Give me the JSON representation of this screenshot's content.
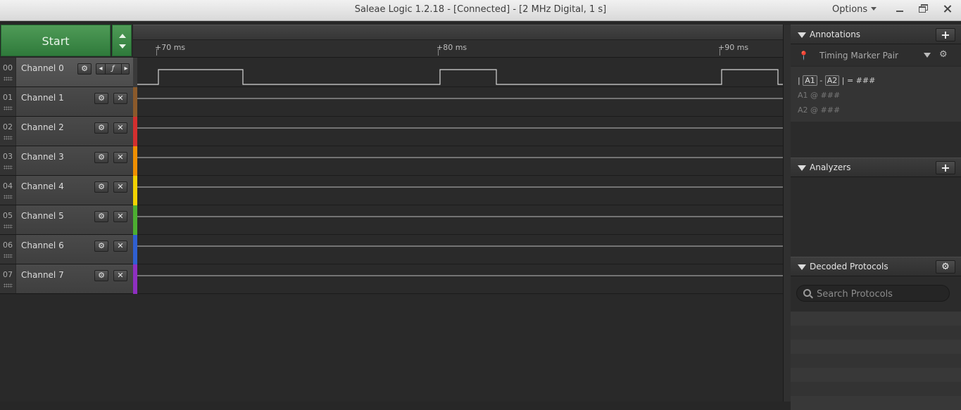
{
  "window": {
    "title": "Saleae Logic 1.2.18 - [Connected] - [2 MHz Digital, 1 s]",
    "options_label": "Options"
  },
  "capture": {
    "start_label": "Start"
  },
  "ruler": {
    "ticks": [
      "+70 ms",
      "+80 ms",
      "+90 ms"
    ]
  },
  "channels": [
    {
      "num": "00",
      "name": "Channel 0",
      "color": "#3a3a3a"
    },
    {
      "num": "01",
      "name": "Channel 1",
      "color": "#8b5a2b"
    },
    {
      "num": "02",
      "name": "Channel 2",
      "color": "#d32f2f"
    },
    {
      "num": "03",
      "name": "Channel 3",
      "color": "#ef8f00"
    },
    {
      "num": "04",
      "name": "Channel 4",
      "color": "#f2d200"
    },
    {
      "num": "05",
      "name": "Channel 5",
      "color": "#4caf30"
    },
    {
      "num": "06",
      "name": "Channel 6",
      "color": "#2f5fd0"
    },
    {
      "num": "07",
      "name": "Channel 7",
      "color": "#8e2fc0"
    }
  ],
  "channel0_trigger": {
    "left": "◂",
    "mid": "ƒ",
    "right": "▸"
  },
  "annotations": {
    "title": "Annotations",
    "add_label": "+",
    "marker_pair_label": "Timing Marker Pair",
    "pin_icon": "pin-icon",
    "diff_a1": "A1",
    "diff_a2": "A2",
    "diff_text_prefix": "|",
    "diff_text_minus": "-",
    "diff_text_suffix": "| = ###",
    "a1_label": "A1",
    "a1_value": "@  ###",
    "a2_label": "A2",
    "a2_value": "@  ###"
  },
  "analyzers": {
    "title": "Analyzers",
    "add_label": "+"
  },
  "decoded": {
    "title": "Decoded Protocols",
    "search_placeholder": "Search Protocols"
  },
  "colors": {
    "accent_green": "#3f8d4a",
    "waveform": "#d6d6d6"
  }
}
